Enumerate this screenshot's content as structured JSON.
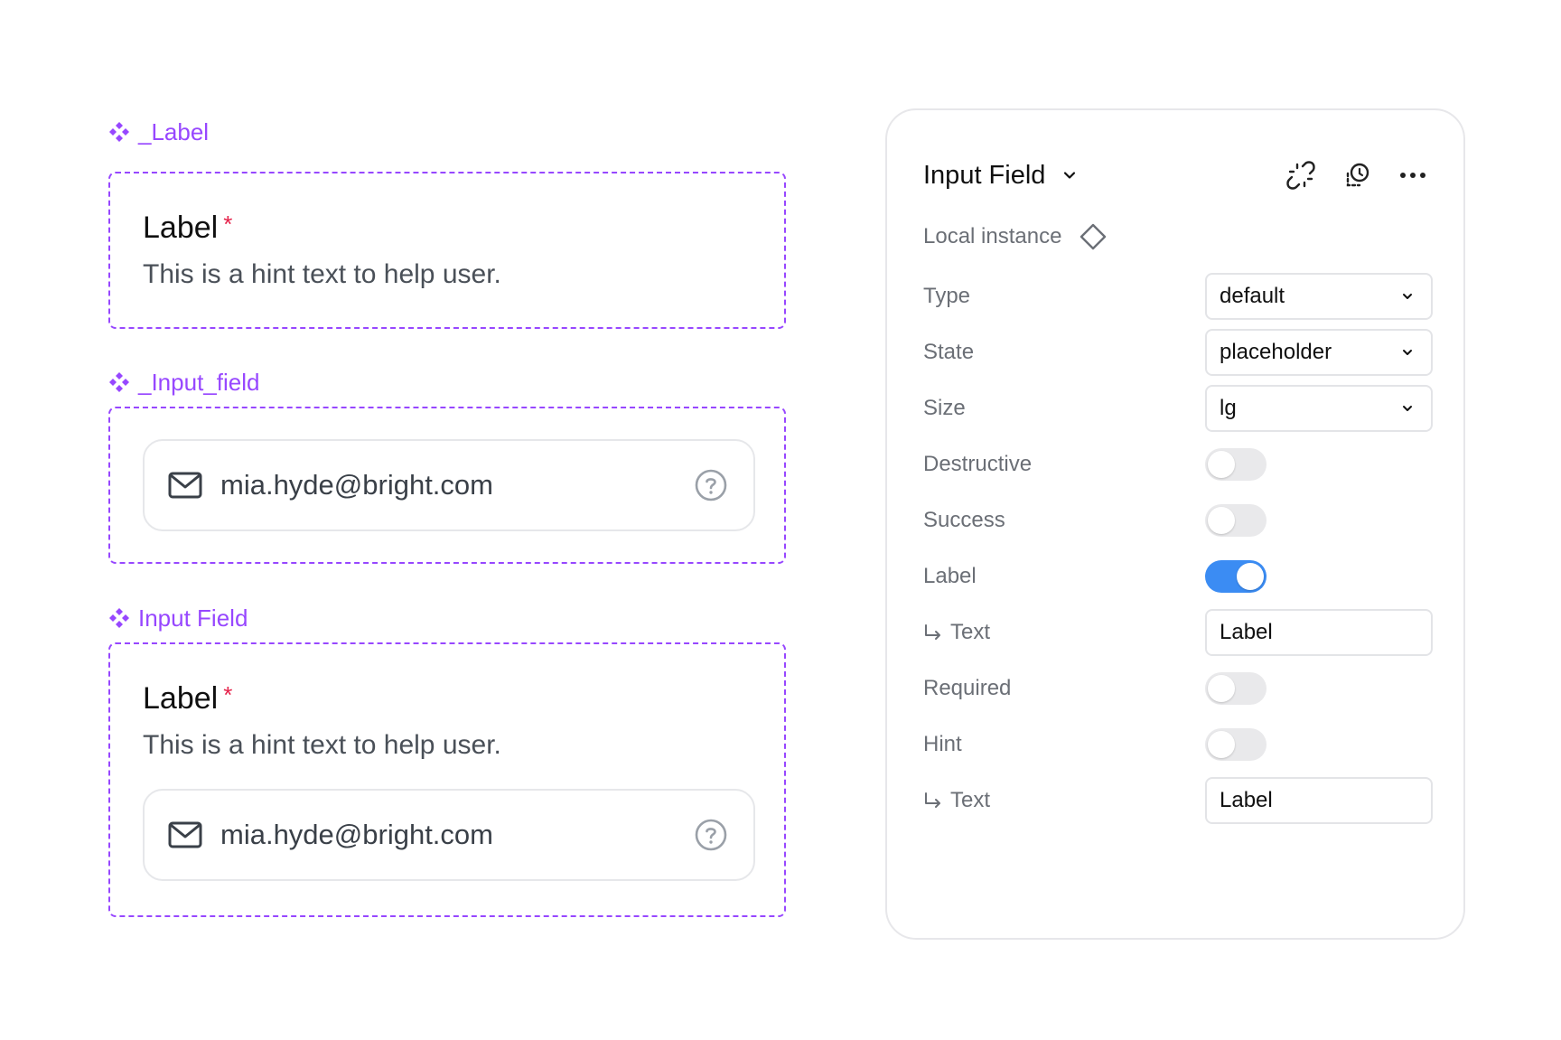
{
  "colors": {
    "component_purple": "#9747ff",
    "required_red": "#e5224a",
    "toggle_on_blue": "#3b8cf3",
    "toggle_off_gray": "#e9e9eb"
  },
  "canvas": {
    "label_component": {
      "title": "_Label",
      "icon": "component-icon",
      "label": "Label",
      "required_mark": "*",
      "hint": "This is a hint text to help user."
    },
    "input_field_component": {
      "title": "_Input_field",
      "icon": "component-icon",
      "leading_icon": "mail-icon",
      "value": "mia.hyde@bright.com",
      "trailing_icon": "help-circle-icon"
    },
    "input_field_full": {
      "title": "Input Field",
      "icon": "component-icon",
      "label": "Label",
      "required_mark": "*",
      "hint": "This is a hint text to help user.",
      "value": "mia.hyde@bright.com"
    }
  },
  "panel": {
    "title": "Input Field",
    "header_icons": [
      "detach-instance-icon",
      "reset-instance-icon",
      "more-options-icon"
    ],
    "local_instance_label": "Local instance",
    "properties": {
      "type": {
        "label": "Type",
        "value": "default"
      },
      "state": {
        "label": "State",
        "value": "placeholder"
      },
      "size": {
        "label": "Size",
        "value": "lg"
      },
      "destructive": {
        "label": "Destructive",
        "on": false
      },
      "success": {
        "label": "Success",
        "on": false
      },
      "label": {
        "label": "Label",
        "on": true
      },
      "label_text": {
        "label": "Text",
        "value": "Label"
      },
      "required": {
        "label": "Required",
        "on": false
      },
      "hint": {
        "label": "Hint",
        "on": false
      },
      "hint_text": {
        "label": "Text",
        "value": "Label"
      }
    }
  }
}
